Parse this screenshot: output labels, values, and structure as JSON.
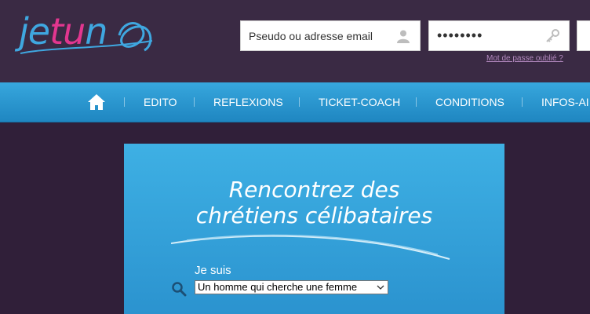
{
  "header": {
    "logo": {
      "part1": "je",
      "part2": "tu",
      "part3": "n"
    },
    "login": {
      "pseudo_placeholder": "Pseudo ou adresse email",
      "password_value": "********",
      "forgot_link": "Mot de passe oublié ?"
    }
  },
  "nav": {
    "home_icon": "home-icon",
    "items": [
      {
        "label": "EDITO"
      },
      {
        "label": "REFLEXIONS"
      },
      {
        "label": "TICKET-COACH"
      },
      {
        "label": "CONDITIONS"
      },
      {
        "label": "INFOS-AI"
      }
    ]
  },
  "hero": {
    "headline_line1": "Rencontrez des",
    "headline_line2": "chrétiens célibataires",
    "je_suis_label": "Je suis",
    "search_icon": "search-icon",
    "select_value": "Un homme qui cherche une femme"
  },
  "colors": {
    "background": "#301f39",
    "header": "#3a2a44",
    "nav": "#2a95d0",
    "panel": "#3eb0e4",
    "logo_blue": "#3fa7e0",
    "logo_pink": "#e2368f"
  }
}
